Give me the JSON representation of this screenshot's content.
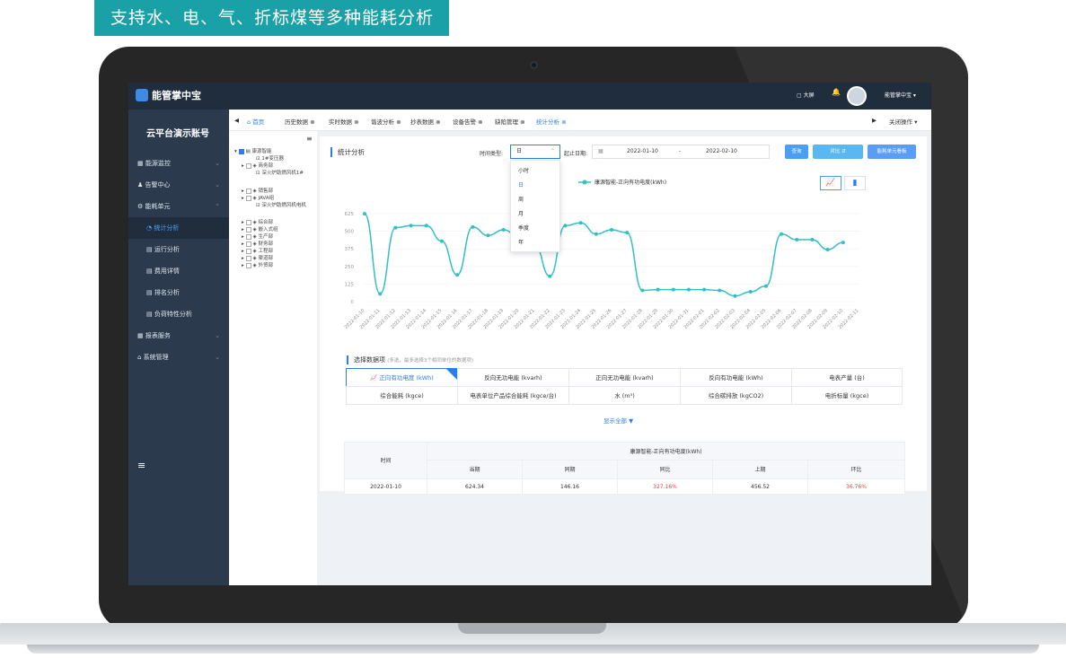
{
  "banner": {
    "text": "支持水、电、气、折标煤等多种能耗分析"
  },
  "app": {
    "title": "能管掌中宝",
    "bigscreen": "大屏",
    "user": "能管掌中宝"
  },
  "sidebar": {
    "account": "云平台演示账号",
    "items": [
      {
        "label": "能源监控",
        "arrow": "⌄"
      },
      {
        "label": "告警中心",
        "arrow": "⌄"
      },
      {
        "label": "能耗单元",
        "arrow": "⌃"
      },
      {
        "label": "统计分析"
      },
      {
        "label": "运行分析"
      },
      {
        "label": "费用详情"
      },
      {
        "label": "排名分析"
      },
      {
        "label": "负荷特性分析"
      },
      {
        "label": "报表服务",
        "arrow": "⌄"
      },
      {
        "label": "系统管理",
        "arrow": "⌄"
      }
    ]
  },
  "tabs": [
    "首页",
    "历史数据",
    "实时数据",
    "谐波分析",
    "抄表数据",
    "设备告警",
    "缺陷管理",
    "统计分析"
  ],
  "tab_close": "关闭操作",
  "tree": [
    "康源智能",
    "1#变压器",
    "商务部",
    "深火炉助燃风机1#",
    "销售部",
    "JAVA组",
    "深火炉助燃风机电机",
    "综合部",
    "嵌入式组",
    "生产部",
    "财务部",
    "工程部",
    "渠道部",
    "外贸部"
  ],
  "filter": {
    "title": "统计分析",
    "time_type_label": "时间类型:",
    "time_type_value": "日",
    "date_label": "起止日期:",
    "date_start": "2022-01-10",
    "date_sep": "-",
    "date_end": "2022-02-10",
    "query": "查询",
    "compare": "对比",
    "board": "能耗单元看板"
  },
  "dropdown": [
    "小时",
    "日",
    "周",
    "月",
    "季度",
    "年"
  ],
  "chart_data": {
    "type": "line",
    "legend": "康源智能-正向有功电度(kWh)",
    "ylim": [
      0,
      625
    ],
    "yticks": [
      0,
      125,
      250,
      375,
      500,
      625
    ],
    "categories": [
      "2022-01-10",
      "2022-01-11",
      "2022-01-12",
      "2022-01-13",
      "2022-01-14",
      "2022-01-15",
      "2022-01-16",
      "2022-01-17",
      "2022-01-18",
      "2022-01-19",
      "2022-01-20",
      "2022-01-21",
      "2022-01-22",
      "2022-01-23",
      "2022-01-24",
      "2022-01-25",
      "2022-01-26",
      "2022-01-27",
      "2022-01-28",
      "2022-01-29",
      "2022-01-30",
      "2022-01-31",
      "2022-02-01",
      "2022-02-02",
      "2022-02-03",
      "2022-02-04",
      "2022-02-05",
      "2022-02-06",
      "2022-02-07",
      "2022-02-08",
      "2022-02-09",
      "2022-02-10",
      "2022-02-11"
    ],
    "values": [
      624,
      55,
      525,
      540,
      540,
      430,
      190,
      530,
      470,
      510,
      460,
      410,
      180,
      540,
      560,
      480,
      510,
      490,
      80,
      85,
      85,
      85,
      85,
      80,
      40,
      70,
      110,
      480,
      440,
      440,
      370,
      420
    ]
  },
  "selector": {
    "title": "选择数据项",
    "hint": "(多选，最多选择3个相同单位的数据项)",
    "items": [
      "正向有功电度 (kWh)",
      "反向无功电能 (kvarh)",
      "正向无功电能 (kvarh)",
      "反向有功电能 (kWh)",
      "电表产量 (台)",
      "综合能耗 (kgce)",
      "电表单位产品综合能耗 (kgce/台)",
      "水 (m³)",
      "综合碳排放 (kgCO2)",
      "电折标量 (kgce)"
    ],
    "show_all": "显示全部 ▼"
  },
  "table": {
    "time_header": "时间",
    "group_header": "康源智能-正向有功电度(kWh)",
    "columns": [
      "当期",
      "同期",
      "同比",
      "上期",
      "环比"
    ],
    "rows": [
      {
        "time": "2022-01-10",
        "current": "624.34",
        "same": "146.16",
        "yoy": "327.16%",
        "prev": "456.52",
        "mom": "36.76%"
      }
    ]
  }
}
